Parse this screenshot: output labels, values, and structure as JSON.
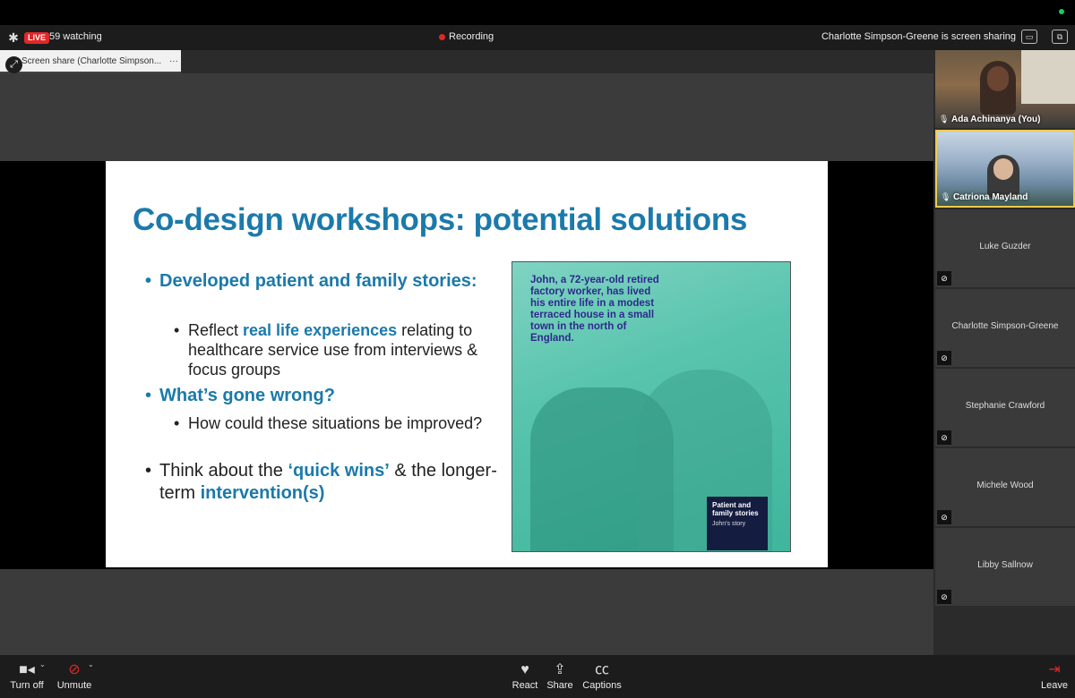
{
  "topbar": {
    "live_badge": "LIVE",
    "watching": "59 watching",
    "recording": "Recording",
    "sharing_notice": "Charlotte Simpson-Greene is screen sharing"
  },
  "share_tab": {
    "label": "Screen share (Charlotte Simpson..."
  },
  "slide": {
    "title": "Co-design workshops: potential solutions",
    "b1": "Developed patient and family stories:",
    "b1a_pre": "Reflect ",
    "b1a_hl": "real life experiences",
    "b1a_post": " relating to healthcare service use from interviews & focus groups",
    "b2": "What’s gone wrong?",
    "b2a": "How could these situations be improved?",
    "b3_pre": "Think about the ",
    "b3_hl1": "‘quick wins’",
    "b3_mid": " & the longer-term ",
    "b3_hl2": "intervention(s)",
    "story_text": "John, a 72-year-old retired factory worker, has lived his entire life in a modest terraced house in a small town in the north of England.",
    "story_tag_title": "Patient and family stories",
    "story_tag_sub": "John's story"
  },
  "participants": [
    {
      "name": "Ada Achinanya (You)"
    },
    {
      "name": "Catriona Mayland"
    },
    {
      "name": "Luke Guzder"
    },
    {
      "name": "Charlotte Simpson-Greene"
    },
    {
      "name": "Stephanie Crawford"
    },
    {
      "name": "Michele Wood"
    },
    {
      "name": "Libby Sallnow"
    }
  ],
  "toolbar": {
    "video": "Turn off",
    "audio": "Unmute",
    "react": "React",
    "share": "Share",
    "captions": "Captions",
    "leave": "Leave"
  },
  "colors": {
    "accent_blue": "#1b7aaa",
    "live_red": "#e02828",
    "active_speaker": "#f2c94c"
  }
}
